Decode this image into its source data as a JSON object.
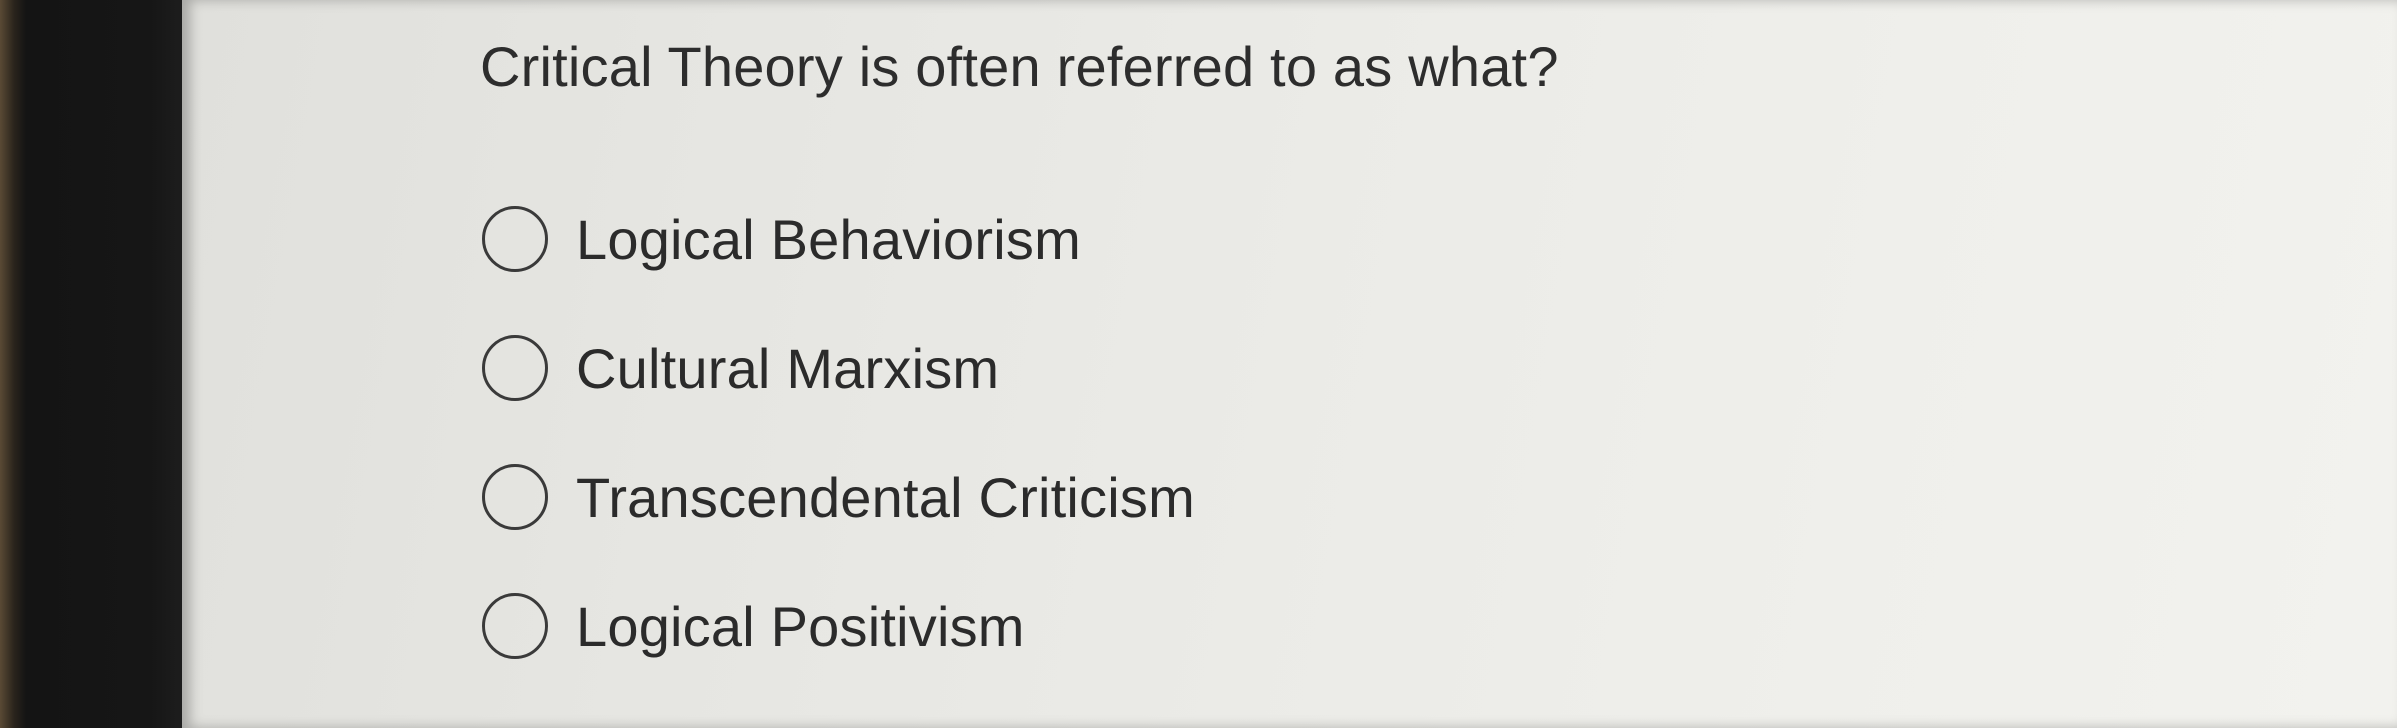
{
  "quiz": {
    "question": "Critical Theory is often referred to as what?",
    "options": [
      {
        "label": "Logical Behaviorism",
        "selected": false
      },
      {
        "label": "Cultural Marxism",
        "selected": false
      },
      {
        "label": "Transcendental Criticism",
        "selected": false
      },
      {
        "label": "Logical Positivism",
        "selected": false
      }
    ]
  }
}
